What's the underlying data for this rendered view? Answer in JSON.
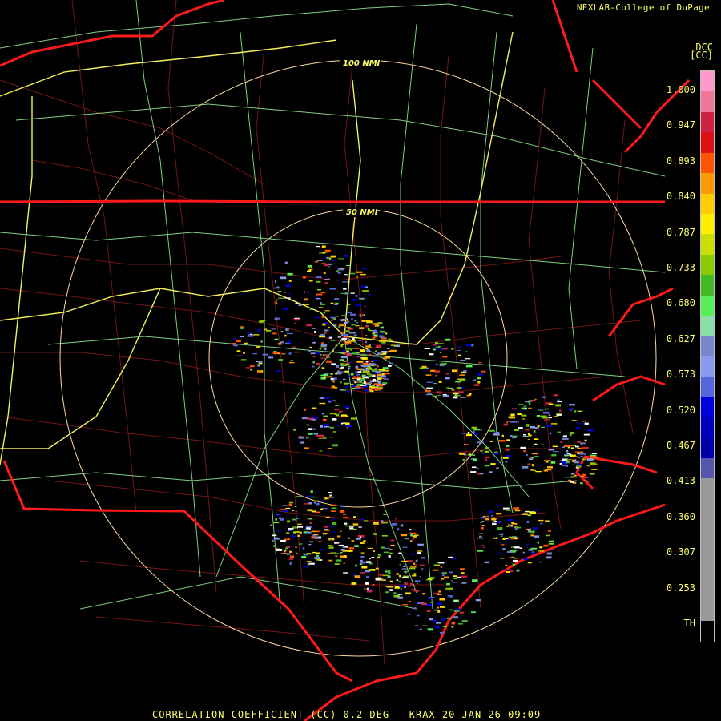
{
  "header": {
    "credit": "NEXLAB-College of DuPage",
    "product_code": "DCC",
    "product_unit": "[CC]"
  },
  "range_rings": [
    {
      "label": "100 NMI"
    },
    {
      "label": "50 NMI"
    }
  ],
  "legend": {
    "ticks": [
      "1.000",
      "0.947",
      "0.893",
      "0.840",
      "0.787",
      "0.733",
      "0.680",
      "0.627",
      "0.573",
      "0.520",
      "0.467",
      "0.413",
      "0.360",
      "0.307",
      "0.253",
      "TH"
    ],
    "colors": [
      "#ff99cc",
      "#ee7799",
      "#cc2244",
      "#dd1111",
      "#ff5500",
      "#ff9900",
      "#ffcc00",
      "#ffee00",
      "#ccdd00",
      "#88cc00",
      "#44bb22",
      "#55ee55",
      "#88ddaa",
      "#7788cc",
      "#8899ee",
      "#5566dd",
      "#0000dd",
      "#0000bb",
      "#0000aa",
      "#5555aa",
      "#999999",
      "#999999",
      "#999999",
      "#999999",
      "#999999",
      "#999999",
      "#999999",
      "#000000"
    ]
  },
  "footer": {
    "caption": "CORRELATION COEFFICIENT (CC) 0.2 DEG - KRAX 20 JAN 26 09:09"
  }
}
